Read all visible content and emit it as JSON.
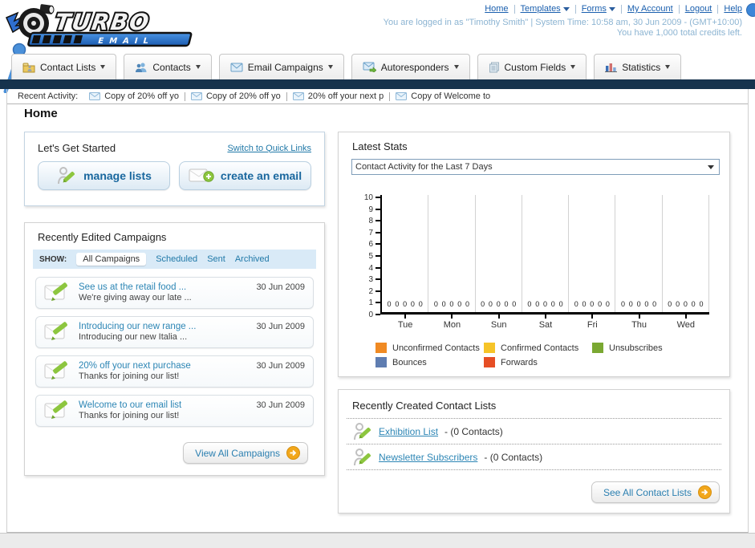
{
  "header": {
    "logo_top": "TURBO",
    "logo_bottom": "E M A I L",
    "nav": [
      {
        "label": "Home",
        "dropdown": false
      },
      {
        "label": "Templates",
        "dropdown": true
      },
      {
        "label": "Forms",
        "dropdown": true
      },
      {
        "label": "My Account",
        "dropdown": false
      },
      {
        "label": "Logout",
        "dropdown": false
      },
      {
        "label": "Help",
        "dropdown": false
      }
    ],
    "login_info": "You are logged in as \"Timothy Smith\" | System Time: 10:58 am, 30 Jun 2009 - (GMT+10:00)",
    "credits_info": "You have 1,000 total credits left."
  },
  "nav_tabs": [
    {
      "label": "Contact Lists"
    },
    {
      "label": "Contacts"
    },
    {
      "label": "Email Campaigns"
    },
    {
      "label": "Autoresponders"
    },
    {
      "label": "Custom Fields"
    },
    {
      "label": "Statistics"
    }
  ],
  "recent_activity": {
    "label": "Recent Activity:",
    "items": [
      "Copy of 20% off yo",
      "Copy of 20% off yo",
      "20% off your next p",
      "Copy of Welcome to"
    ]
  },
  "page_title": "Home",
  "get_started": {
    "title": "Let's Get Started",
    "switch_link": "Switch to Quick Links",
    "manage_lists_label": "manage lists",
    "create_email_label": "create an email"
  },
  "campaigns": {
    "title": "Recently Edited Campaigns",
    "show_label": "SHOW:",
    "filters": [
      "All Campaigns",
      "Scheduled",
      "Sent",
      "Archived"
    ],
    "active_filter": "All Campaigns",
    "items": [
      {
        "title": "See us at the retail food ...",
        "subtitle": "We're giving away our late ...",
        "date": "30 Jun 2009"
      },
      {
        "title": "Introducing our new range ...",
        "subtitle": "Introducing our new Italia ...",
        "date": "30 Jun 2009"
      },
      {
        "title": "20% off your next purchase",
        "subtitle": "Thanks for joining our list!",
        "date": "30 Jun 2009"
      },
      {
        "title": "Welcome to our email list",
        "subtitle": "Thanks for joining our list!",
        "date": "30 Jun 2009"
      }
    ],
    "view_all_label": "View All Campaigns"
  },
  "latest_stats": {
    "title": "Latest Stats",
    "period_selected": "Contact Activity for the Last 7 Days",
    "chart_data": {
      "type": "bar",
      "title": "Contact Activity for the Last 7 Days",
      "categories": [
        "Tue",
        "Mon",
        "Sun",
        "Sat",
        "Fri",
        "Thu",
        "Wed"
      ],
      "series": [
        {
          "name": "Unconfirmed Contacts",
          "color": "#f08a23",
          "values": [
            0,
            0,
            0,
            0,
            0,
            0,
            0
          ]
        },
        {
          "name": "Confirmed Contacts",
          "color": "#f6c428",
          "values": [
            0,
            0,
            0,
            0,
            0,
            0,
            0
          ]
        },
        {
          "name": "Unsubscribes",
          "color": "#7aa832",
          "values": [
            0,
            0,
            0,
            0,
            0,
            0,
            0
          ]
        },
        {
          "name": "Bounces",
          "color": "#5f7db1",
          "values": [
            0,
            0,
            0,
            0,
            0,
            0,
            0
          ]
        },
        {
          "name": "Forwards",
          "color": "#e64e25",
          "values": [
            0,
            0,
            0,
            0,
            0,
            0,
            0
          ]
        }
      ],
      "ylim": [
        0,
        10
      ],
      "ytick_step": 1,
      "grid": "vertical",
      "legend_position": "bottom",
      "value_labels_shown": true
    }
  },
  "contact_lists": {
    "title": "Recently Created Contact Lists",
    "items": [
      {
        "name": "Exhibition List",
        "suffix": " - (0 Contacts)"
      },
      {
        "name": "Newsletter Subscribers",
        "suffix": " - (0 Contacts)"
      }
    ],
    "see_all_label": "See All Contact Lists"
  },
  "colors": {
    "dark_bar": "#16334d",
    "link_blue": "#2179a8",
    "header_info_blue": "#8cb4d2",
    "button_orange": "#f2a71b",
    "pencil_green": "#8dc63f"
  }
}
